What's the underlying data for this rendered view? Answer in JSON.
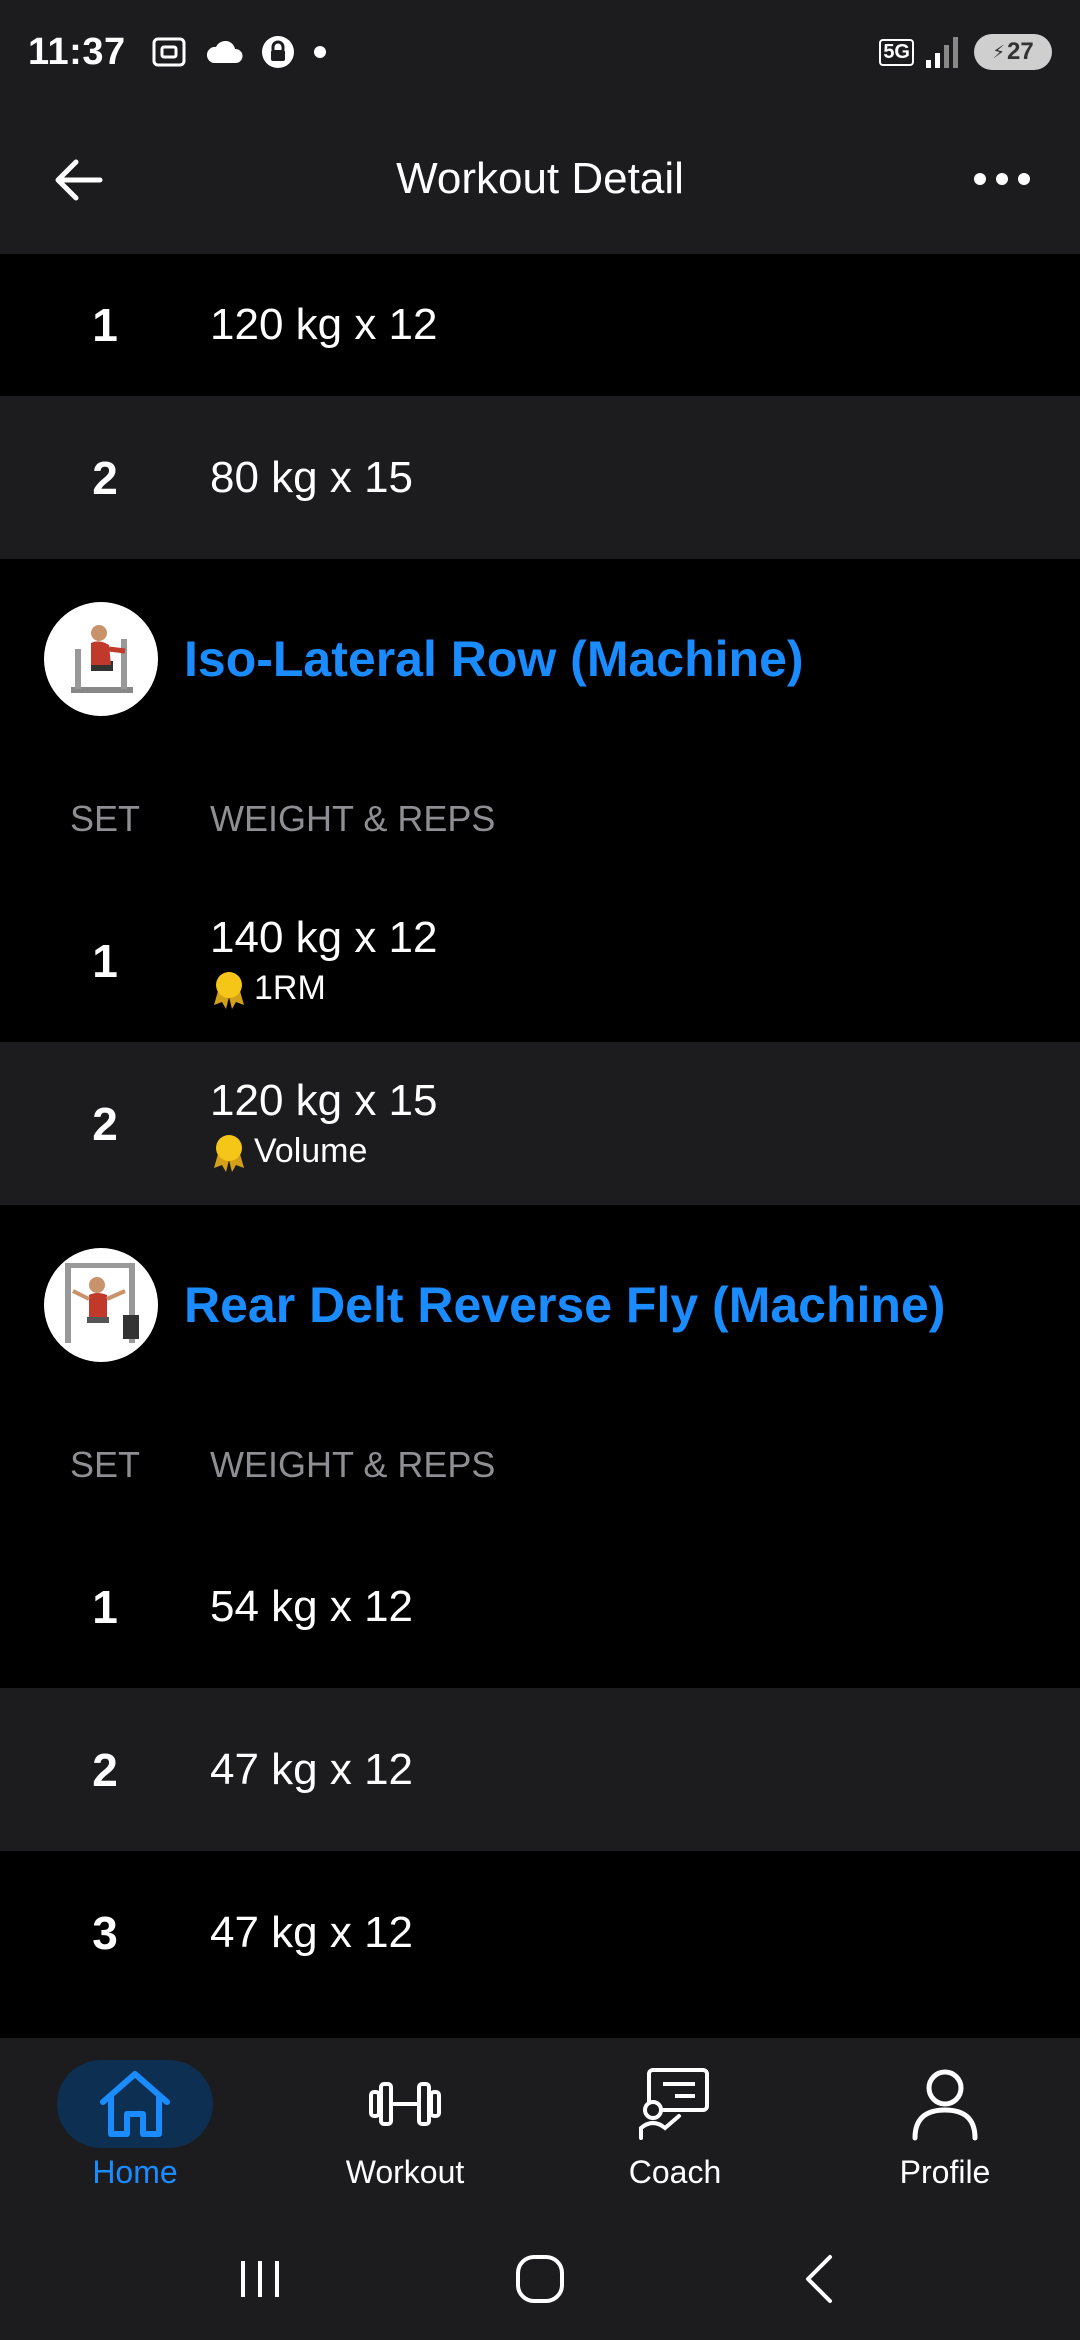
{
  "status_bar": {
    "time": "11:37",
    "network": "5G",
    "battery": "27"
  },
  "header": {
    "title": "Workout Detail"
  },
  "top_sets": [
    {
      "num": "1",
      "value": "120 kg x 12"
    },
    {
      "num": "2",
      "value": "80 kg x 15"
    }
  ],
  "exercises": [
    {
      "name": "Iso-Lateral Row (Machine)",
      "col_set": "SET",
      "col_weight": "WEIGHT & REPS",
      "sets": [
        {
          "num": "1",
          "value": "140 kg x 12",
          "pr": "1RM"
        },
        {
          "num": "2",
          "value": "120 kg x 15",
          "pr": "Volume"
        }
      ]
    },
    {
      "name": "Rear Delt Reverse Fly (Machine)",
      "col_set": "SET",
      "col_weight": "WEIGHT & REPS",
      "sets": [
        {
          "num": "1",
          "value": "54 kg x 12"
        },
        {
          "num": "2",
          "value": "47 kg x 12"
        },
        {
          "num": "3",
          "value": "47 kg x 12"
        }
      ]
    }
  ],
  "bottom_nav": {
    "items": [
      {
        "label": "Home",
        "icon": "home-icon",
        "active": true
      },
      {
        "label": "Workout",
        "icon": "dumbbell-icon",
        "active": false
      },
      {
        "label": "Coach",
        "icon": "coach-icon",
        "active": false
      },
      {
        "label": "Profile",
        "icon": "profile-icon",
        "active": false
      }
    ]
  },
  "colors": {
    "accent": "#1a8cff",
    "background": "#000000",
    "surface": "#1c1c1e",
    "muted": "#8e8e93",
    "medal": "#f5c518"
  }
}
